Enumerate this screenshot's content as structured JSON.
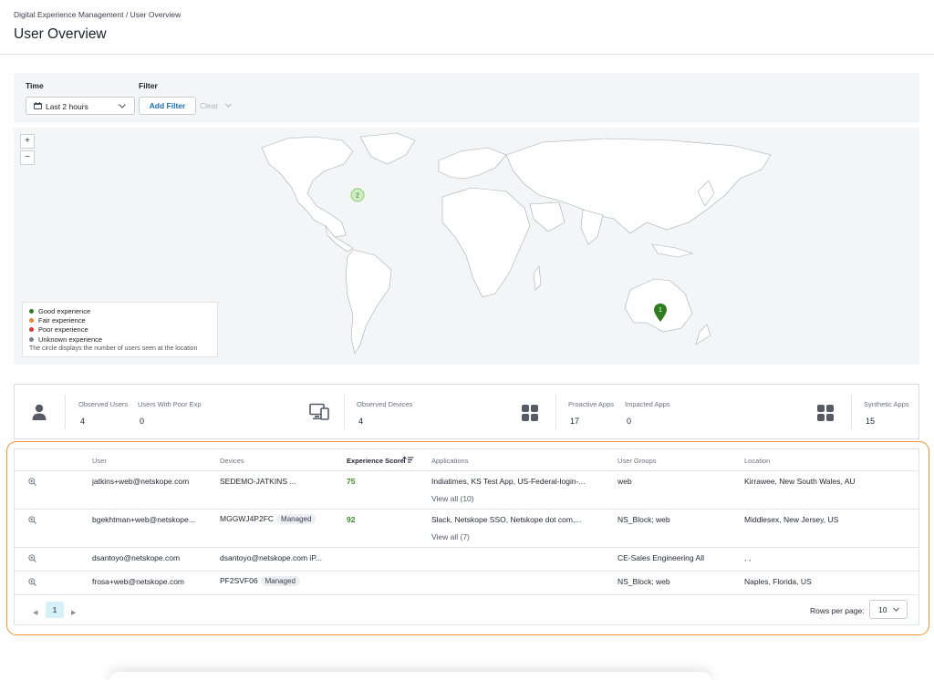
{
  "header": {
    "breadcrumb": "Digital Experience Management / User Overview",
    "title": "User Overview"
  },
  "filters": {
    "time_label": "Time",
    "filter_label": "Filter",
    "time_value": "Last 2 hours",
    "add_filter": "Add Filter",
    "clear": "Clear"
  },
  "map": {
    "zoom_in": "+",
    "zoom_out": "−",
    "markers": [
      {
        "count": "2",
        "location": "US East",
        "color": "#cfeec3"
      },
      {
        "count": "1",
        "location": "Australia",
        "color": "#2e7d1e"
      }
    ],
    "legend": [
      {
        "label": "Good experience",
        "color": "#2e7d1e"
      },
      {
        "label": "Fair experience",
        "color": "#e8862e"
      },
      {
        "label": "Poor experience",
        "color": "#d43b2f"
      },
      {
        "label": "Unknown experience",
        "color": "#7a7f88"
      }
    ],
    "legend_note": "The circle displays the number of users seen at the location"
  },
  "stats": {
    "observed_users": {
      "label": "Observed Users",
      "value": "4"
    },
    "poor_exp_users": {
      "label": "Users With Poor Exp",
      "value": "0"
    },
    "observed_devices": {
      "label": "Observed Devices",
      "value": "4"
    },
    "proactive_apps": {
      "label": "Proactive Apps",
      "value": "17"
    },
    "impacted_apps": {
      "label": "Impacted Apps",
      "value": "0"
    },
    "synthetic_apps": {
      "label": "Synthetic Apps",
      "value": "15"
    }
  },
  "table": {
    "columns": {
      "user": "User",
      "devices": "Devices",
      "score": "Experience Score",
      "applications": "Applications",
      "groups": "User Groups",
      "location": "Location"
    },
    "rows": [
      {
        "user": "jatkins+web@netskope.com",
        "device": "SEDEMO-JATKINS ...",
        "badge": "",
        "score": "75",
        "apps": "Indiatimes, KS Test App, US-Federal-login-...",
        "view_all": "View all (10)",
        "groups": "web",
        "location": "Kirrawee, New South Wales, AU"
      },
      {
        "user": "bgekhtman+web@netskope...",
        "device": "MGGWJ4P2FC",
        "badge": "Managed",
        "score": "92",
        "apps": "Slack, Netskope SSO, Netskope dot com,...",
        "view_all": "View all (7)",
        "groups": "NS_Block; web",
        "location": "Middlesex, New Jersey, US"
      },
      {
        "user": "dsantoyo@netskope.com",
        "device": "dsantoyo@netskope.com iP...",
        "badge": "",
        "score": "",
        "apps": "",
        "view_all": "",
        "groups": "CE-Sales Engineering All",
        "location": ", ,"
      },
      {
        "user": "frosa+web@netskope.com",
        "device": "PF2SVF06",
        "badge": "Managed",
        "score": "",
        "apps": "",
        "view_all": "",
        "groups": "NS_Block; web",
        "location": "Naples, Florida, US"
      }
    ],
    "pagination": {
      "prev": "◀",
      "next": "▶",
      "current_page": "1",
      "rows_per_page_label": "Rows per page:",
      "rows_per_page_value": "10"
    }
  },
  "colors": {
    "accent": "#1c6fb8",
    "highlight_border": "#f0922f",
    "score_good": "#3d8b26"
  }
}
